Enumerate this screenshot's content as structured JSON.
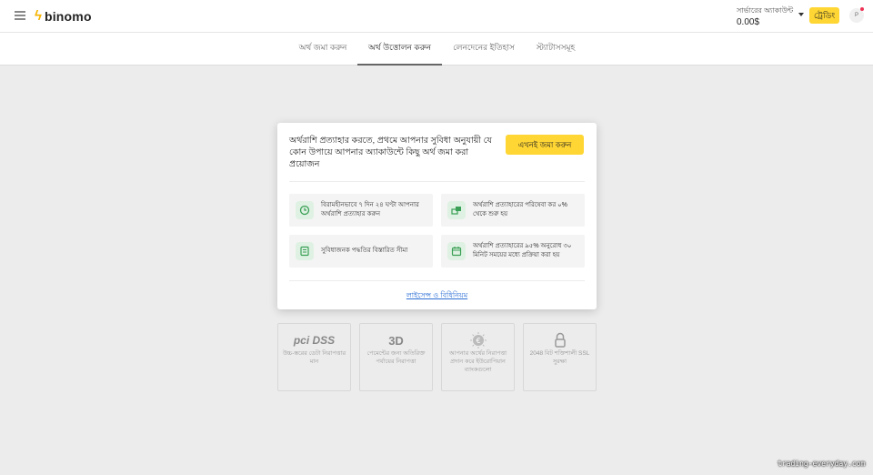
{
  "header": {
    "logo_text": "binomo",
    "account_label": "সার্ভারের অ্যাকাউন্ট",
    "account_balance": "0.00$",
    "trade_button": "ট্রেডিং",
    "profile_initial": "P"
  },
  "tabs": [
    {
      "label": "অর্থ জমা করুন",
      "active": false
    },
    {
      "label": "অর্থ উত্তোলন করুন",
      "active": true
    },
    {
      "label": "লেনদেনের ইতিহাস",
      "active": false
    },
    {
      "label": "স্ট্যাটাসসমূহ",
      "active": false
    }
  ],
  "card": {
    "message": "অর্থরাশি প্রত্যাহার করতে, প্রথমে আপনার সুবিধা অনুযায়ী যে কোন উপায়ে আপনার অ্যাকাউন্টে কিছু অর্থ জমা করা প্রয়োজন",
    "deposit_button": "এখনই জমা করুন",
    "features": [
      {
        "icon": "clock-icon",
        "text": "বিরামহীনভাবে ৭ দিন ২৪ ঘণ্টা আপনার অর্থরাশি প্রত্যাহার করুন"
      },
      {
        "icon": "money-stack-icon",
        "text": "অর্থরাশি প্রত্যাহারের পরিষেবা কর ০% থেকে শুরু হয়"
      },
      {
        "icon": "card-icon",
        "text": "সুবিধাজনক পদ্ধতির বিস্তারিত সীমা"
      },
      {
        "icon": "calendar-icon",
        "text": "অর্থরাশি প্রত্যাহারের ৯৫% অনুরোধ ৩০ মিনিট সময়ের মধ্যে প্রক্রিয়া করা হয়"
      }
    ],
    "license_link": "লাইসেন্স ও বিধিনিয়ম"
  },
  "badges": [
    {
      "icon": "pci-dss-icon",
      "icon_text": "pci DSS",
      "text": "উচ্চ-স্তরের ডেটা নিরাপত্তার মান"
    },
    {
      "icon": "3d-secure-icon",
      "icon_text": "3D",
      "text": "পেমেন্টের জন্য অতিরিক্ত পর্যায়ের নিরাপত্তা"
    },
    {
      "icon": "euro-shield-icon",
      "icon_text": "€",
      "text": "আপনার অর্থের নিরাপত্তা প্রদান করে ইউরোপিয়ান ব্যাংকগুলো"
    },
    {
      "icon": "lock-icon",
      "icon_text": "",
      "text": "2048 বিট শক্তিশালী SSL সুরক্ষা"
    }
  ],
  "watermark": "trading-everyday.com",
  "colors": {
    "accent": "#ffd633",
    "logo": "#f5b400",
    "link": "#2c6ed5",
    "icon_bg": "#dff1e3",
    "icon": "#3aa055"
  }
}
